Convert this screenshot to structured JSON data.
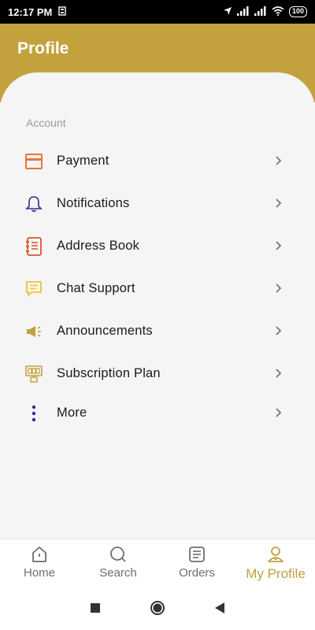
{
  "status": {
    "time": "12:17 PM",
    "battery": "100"
  },
  "header": {
    "title": "Profile"
  },
  "section": {
    "label": "Account"
  },
  "menu": [
    {
      "label": "Payment",
      "icon": "payment-card-icon"
    },
    {
      "label": "Notifications",
      "icon": "bell-icon"
    },
    {
      "label": "Address Book",
      "icon": "address-book-icon"
    },
    {
      "label": "Chat Support",
      "icon": "chat-icon"
    },
    {
      "label": "Announcements",
      "icon": "megaphone-icon"
    },
    {
      "label": "Subscription Plan",
      "icon": "subscription-icon"
    },
    {
      "label": "More",
      "icon": "more-vertical-icon"
    }
  ],
  "nav": {
    "tabs": [
      {
        "label": "Home",
        "icon": "home-icon"
      },
      {
        "label": "Search",
        "icon": "search-icon"
      },
      {
        "label": "Orders",
        "icon": "orders-icon"
      },
      {
        "label": "My Profile",
        "icon": "profile-icon",
        "active": true
      }
    ]
  },
  "colors": {
    "accent": "#c3a13d",
    "payment": "#e8743c",
    "bell": "#3a2a8c",
    "address": "#d9542c",
    "chat": "#f2c230",
    "gold": "#c3a13d",
    "more": "#3a2a8c"
  }
}
